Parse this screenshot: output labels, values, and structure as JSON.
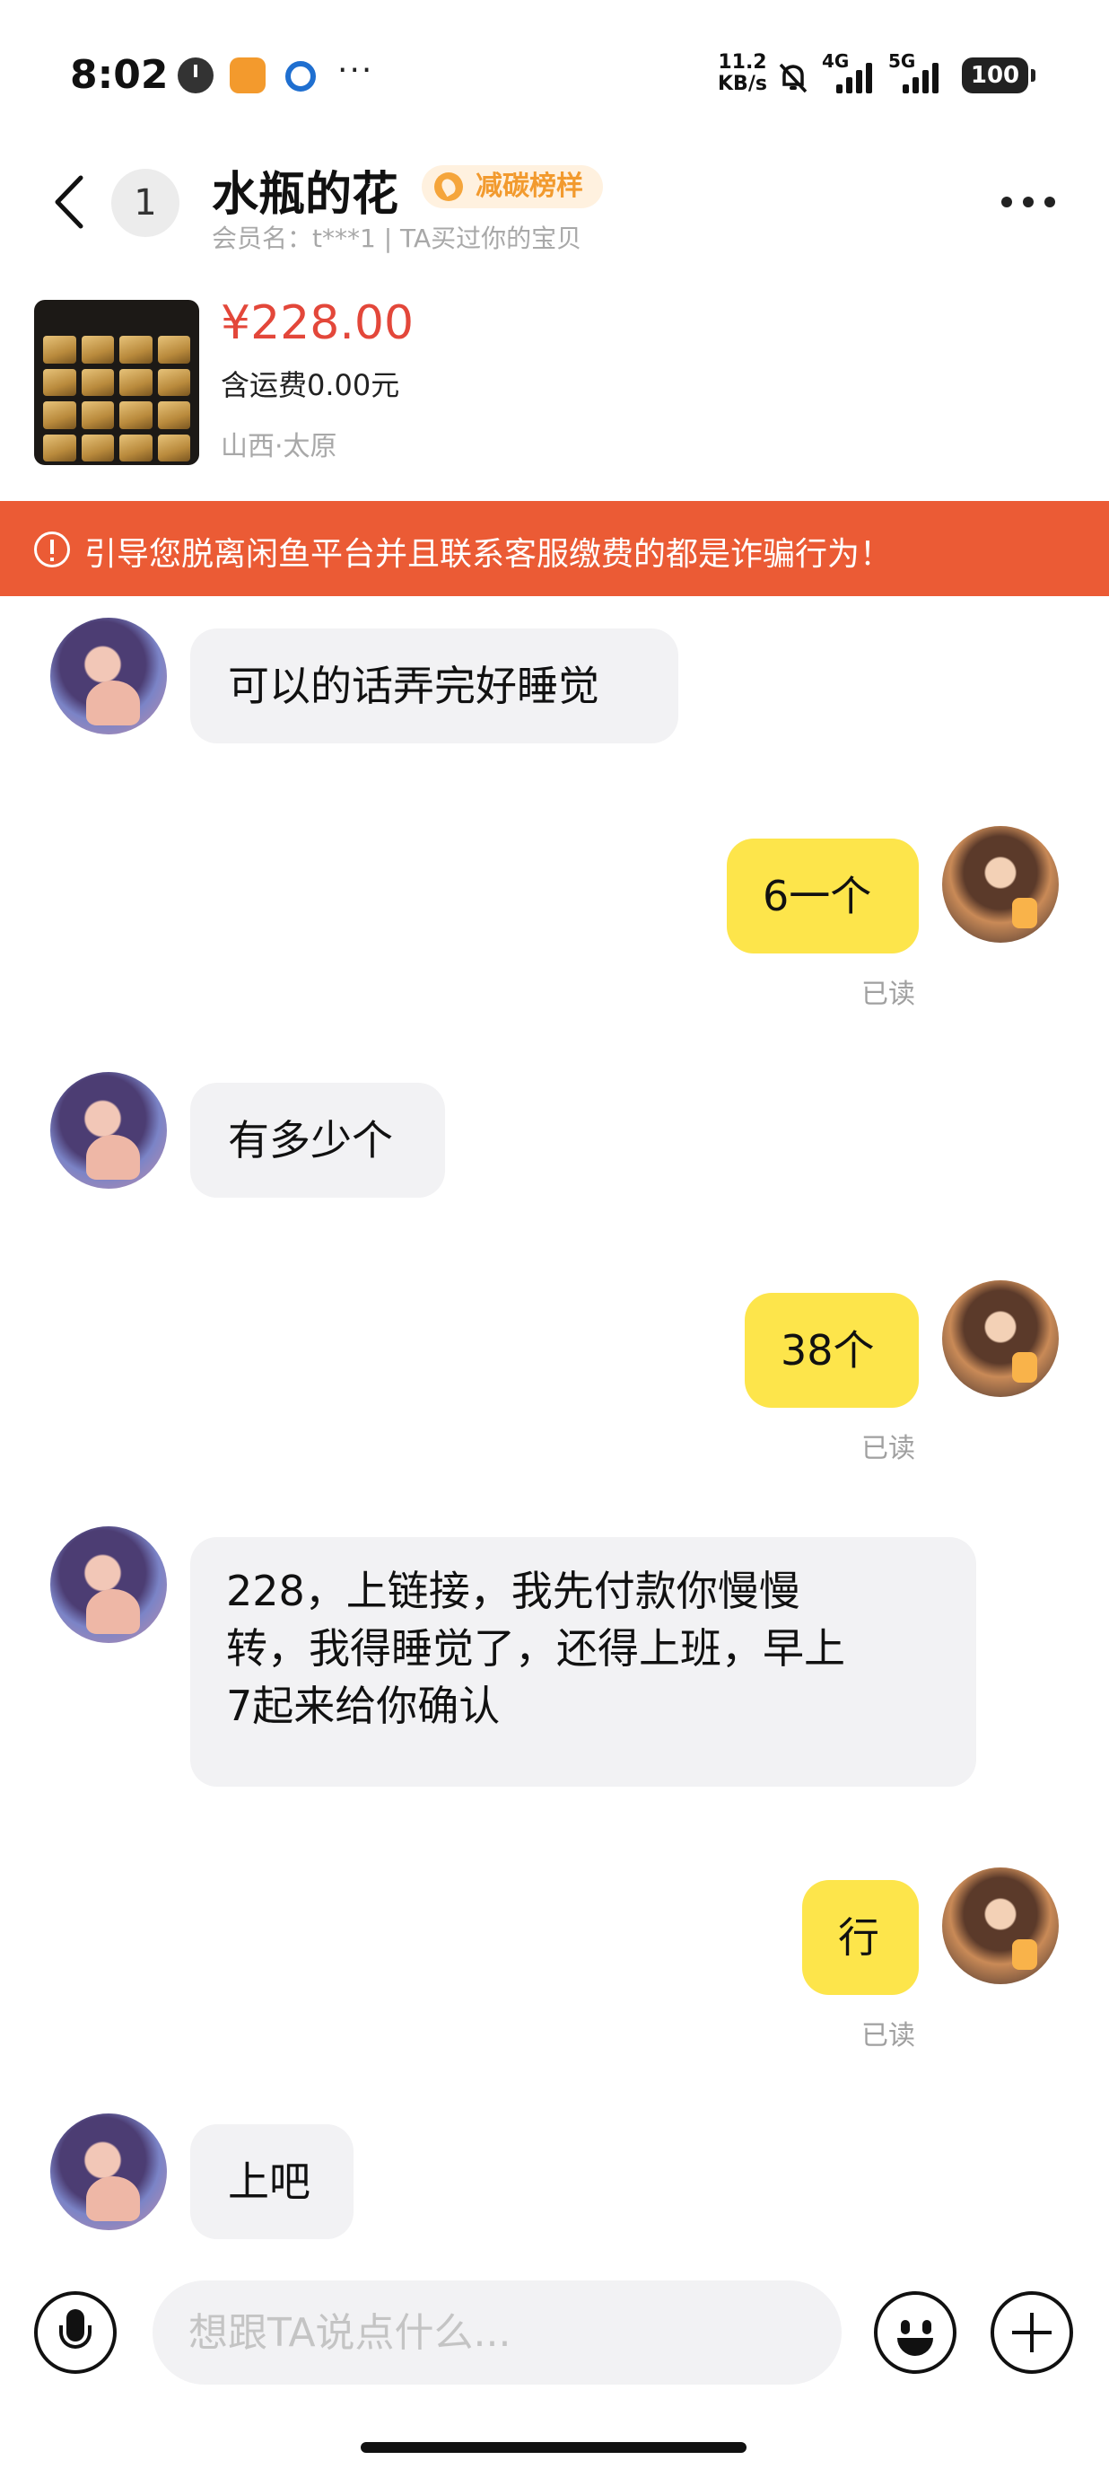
{
  "status_bar": {
    "time": "8:02",
    "more": "···",
    "net_speed_value": "11.2",
    "net_speed_unit": "KB/s",
    "signal_1_label": "4G",
    "signal_2_label": "5G",
    "battery": "100",
    "icons": [
      "clock-icon",
      "orange-app-icon",
      "blue-app-icon",
      "mute-bell-icon",
      "signal-4g-icon",
      "signal-5g-icon",
      "battery-icon"
    ]
  },
  "header": {
    "unread_count": "1",
    "contact_name": "水瓶的花",
    "tag_label": "减碳榜样",
    "member_info": "会员名：t***1 | TA买过你的宝贝"
  },
  "product": {
    "price": "¥228.00",
    "shipping": "含运费0.00元",
    "location": "山西·太原"
  },
  "warning": {
    "text": "引导您脱离闲鱼平台并且联系客服缴费的都是诈骗行为！"
  },
  "messages": [
    {
      "from": "them",
      "text": "可以的话弄完好睡觉"
    },
    {
      "from": "me",
      "text": "6一个",
      "status": "已读"
    },
    {
      "from": "them",
      "text": "有多少个"
    },
    {
      "from": "me",
      "text": "38个",
      "status": "已读"
    },
    {
      "from": "them",
      "text_lines": [
        "228，上链接，我先付款你慢慢",
        "转，我得睡觉了，还得上班，早上",
        "7起来给你确认"
      ]
    },
    {
      "from": "me",
      "text": "行",
      "status": "已读"
    },
    {
      "from": "them",
      "text": "上吧"
    }
  ],
  "input": {
    "placeholder": "想跟TA说点什么..."
  },
  "colors": {
    "warning_bg": "#eb5b35",
    "my_bubble": "#fde54b",
    "their_bubble": "#f2f2f4",
    "price": "#e3473a",
    "tag_text": "#f29a2e",
    "tag_bg": "#fff1df"
  }
}
